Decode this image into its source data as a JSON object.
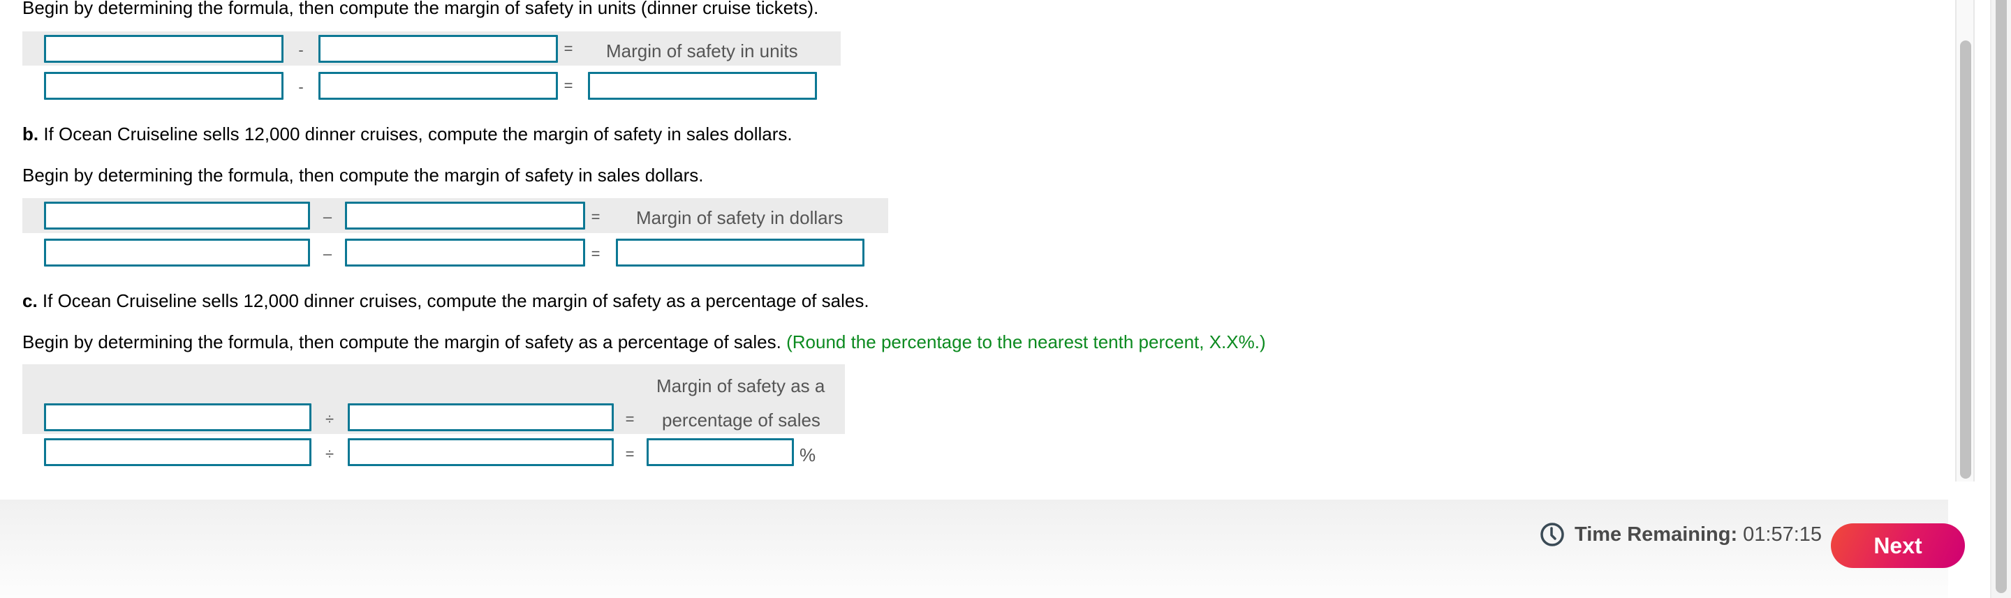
{
  "part_a": {
    "instruction": "Begin by determining the formula, then compute the margin of safety in units (dinner cruise tickets).",
    "operator": "-",
    "equals": "=",
    "result_label": "Margin of safety in units"
  },
  "part_b": {
    "letter": "b.",
    "question": " If Ocean Cruiseline sells 12,000 dinner cruises, compute the margin of safety in sales dollars.",
    "instruction": "Begin by determining the formula, then compute the margin of safety in sales dollars.",
    "operator": "–",
    "equals": "=",
    "result_label": "Margin of safety in dollars"
  },
  "part_c": {
    "letter": "c.",
    "question": " If Ocean Cruiseline sells 12,000 dinner cruises, compute the margin of safety as a percentage of sales.",
    "instruction": "Begin by determining the formula, then compute the margin of safety as a percentage of sales.",
    "hint": " (Round the percentage to the nearest  tenth percent, X.X%.)",
    "operator": "÷",
    "equals": "=",
    "result_label_line1": "Margin of safety as a",
    "result_label_line2": "percentage of sales",
    "unit": "%"
  },
  "inputs": {
    "a_formula_1": "",
    "a_formula_2": "",
    "a_value_1": "",
    "a_value_2": "",
    "a_result": "",
    "b_formula_1": "",
    "b_formula_2": "",
    "b_value_1": "",
    "b_value_2": "",
    "b_result": "",
    "c_formula_1": "",
    "c_formula_2": "",
    "c_value_1": "",
    "c_value_2": "",
    "c_result": ""
  },
  "footer": {
    "timer_label": "Time Remaining:",
    "timer_value": "01:57:15",
    "next_label": "Next"
  },
  "colors": {
    "input_border": "#0c7894",
    "hint_green": "#0b8a1f",
    "next_gradient_start": "#f0483a",
    "next_gradient_end": "#cf0072"
  }
}
